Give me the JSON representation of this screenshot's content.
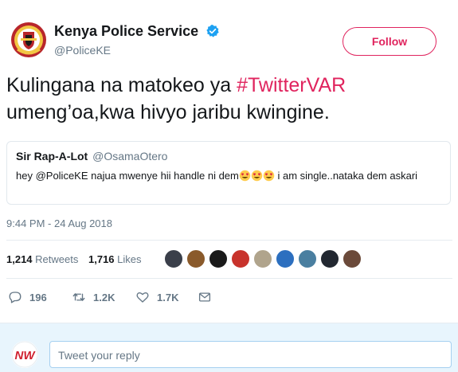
{
  "author": {
    "display_name": "Kenya Police Service",
    "handle": "@PoliceKE",
    "follow_label": "Follow"
  },
  "tweet": {
    "text_before": "Kulingana na matokeo ya ",
    "hashtag": "#TwitterVAR",
    "text_after": " umeng’oa,kwa hivyo jaribu kwingine."
  },
  "quote": {
    "name": "Sir Rap-A-Lot",
    "handle": "@OsamaOtero",
    "text_before": "hey @PoliceKE najua mwenye hii handle ni dem",
    "text_after": " i am single..nataka dem askari"
  },
  "timestamp": "9:44 PM - 24 Aug 2018",
  "stats": {
    "retweets_count": "1,214",
    "retweets_label": "Retweets",
    "likes_count": "1,716",
    "likes_label": "Likes"
  },
  "actions": {
    "replies": "196",
    "retweets": "1.2K",
    "likes": "1.7K"
  },
  "reply": {
    "placeholder": "Tweet your reply",
    "avatar_text": "NW"
  },
  "colors": {
    "accent": "#e0245e",
    "verified": "#1da1f2",
    "muted": "#657786",
    "reply_bg": "#e8f5fd"
  }
}
